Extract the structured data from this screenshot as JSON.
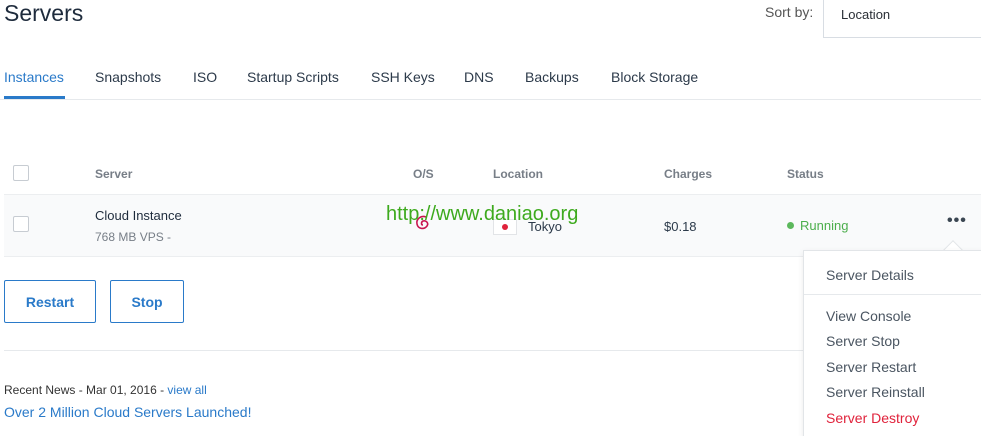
{
  "header": {
    "title": "Servers",
    "sort_label": "Sort by:",
    "sort_value": "Location"
  },
  "tabs": [
    {
      "label": "Instances",
      "active": true
    },
    {
      "label": "Snapshots"
    },
    {
      "label": "ISO"
    },
    {
      "label": "Startup Scripts"
    },
    {
      "label": "SSH Keys"
    },
    {
      "label": "DNS"
    },
    {
      "label": "Backups"
    },
    {
      "label": "Block Storage"
    }
  ],
  "table": {
    "columns": [
      "Server",
      "O/S",
      "Location",
      "Charges",
      "Status"
    ],
    "rows": [
      {
        "name": "Cloud Instance",
        "plan": "768 MB VPS -",
        "os_icon": "debian-icon",
        "location": "Tokyo",
        "flag": "japan-flag-icon",
        "charges": "$0.18",
        "status": "Running"
      }
    ]
  },
  "watermark": "http://www.daniao.org",
  "actions": {
    "restart": "Restart",
    "stop": "Stop"
  },
  "news": {
    "prefix": "Recent News - Mar 01, 2016 -",
    "view_all": "view all",
    "headline": "Over 2 Million Cloud Servers Launched!"
  },
  "menu": {
    "items": [
      "Server Details",
      "View Console",
      "Server Stop",
      "Server Restart",
      "Server Reinstall",
      "Server Destroy"
    ]
  },
  "colors": {
    "accent": "#2a7ac9",
    "running": "#4cae4c",
    "danger": "#e0223b"
  }
}
